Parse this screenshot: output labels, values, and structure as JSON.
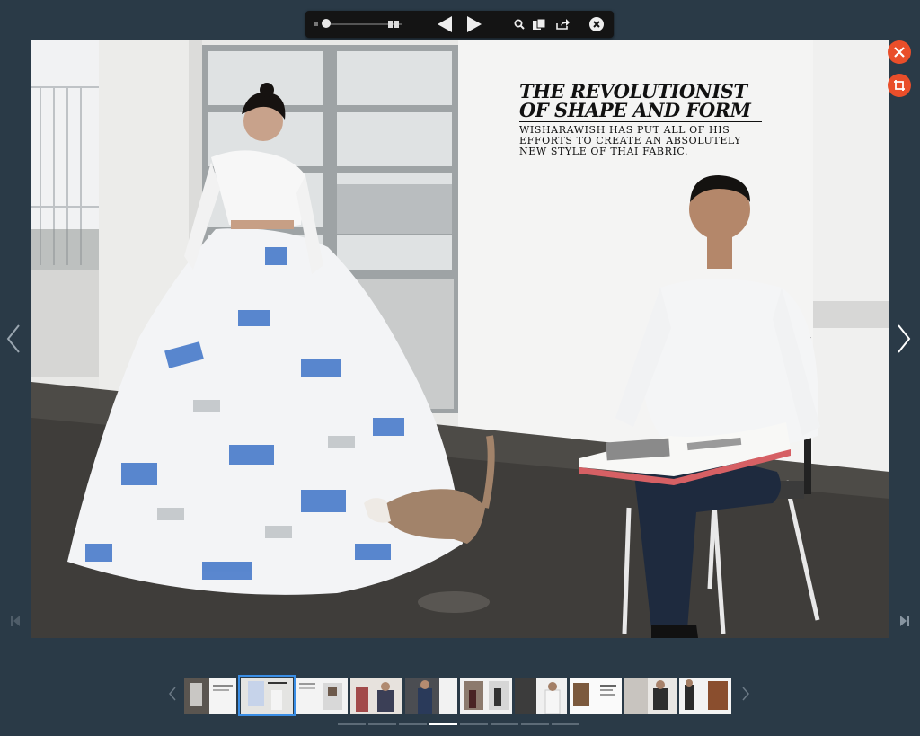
{
  "toolbar": {
    "icons": [
      "zoom-slider",
      "two-page-icon",
      "prev-page-icon",
      "next-page-icon",
      "search-icon",
      "thumbnails-icon",
      "share-icon",
      "close-icon"
    ],
    "zoom_level": 0.05
  },
  "article": {
    "headline": "THE REVOLUTIONIST OF SHAPE AND FORM",
    "subhead": "WISHARAWISH HAS PUT ALL OF HIS EFFORTS TO CREATE AN ABSOLUTELY NEW STYLE OF THAI FABRIC."
  },
  "side_buttons": {
    "close_icon": "close-icon",
    "crop_icon": "crop-icon",
    "accent": "#e94e2a"
  },
  "navigation": {
    "prev_arrow": "chevron-left-icon",
    "next_arrow": "chevron-right-icon",
    "first_page": "first-page-icon",
    "last_page": "last-page-icon"
  },
  "thumbnails": {
    "count": 10,
    "active_index": 1
  },
  "pagination": {
    "count": 8,
    "active_index": 3
  },
  "colors": {
    "background": "#2a3a47",
    "toolbar": "#141414",
    "active_thumb": "#3a8ee6"
  }
}
